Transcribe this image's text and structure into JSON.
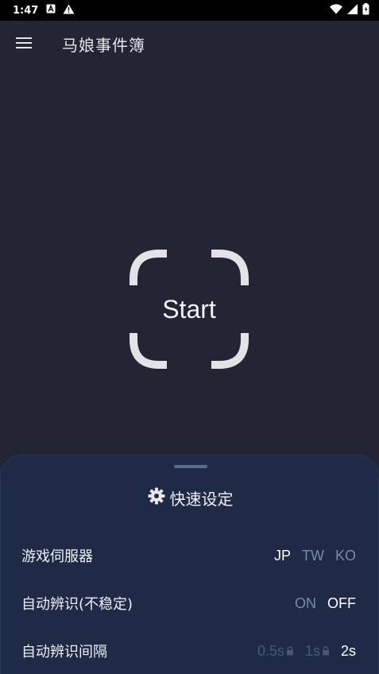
{
  "status_bar": {
    "time": "1:47",
    "left_icons": [
      "a-notification-icon",
      "warning-icon"
    ],
    "right_icons": [
      "wifi-icon",
      "cell-signal-icon",
      "battery-icon"
    ]
  },
  "app_bar": {
    "title": "马娘事件簿",
    "menu_icon": "hamburger-menu-icon"
  },
  "start": {
    "label": "Start"
  },
  "quick_settings": {
    "title": "快速设定",
    "icon": "gear-icon",
    "rows": [
      {
        "label": "游戏伺服器",
        "options": [
          {
            "label": "JP",
            "state": "active"
          },
          {
            "label": "TW",
            "state": "inactive"
          },
          {
            "label": "KO",
            "state": "inactive"
          }
        ]
      },
      {
        "label": "自动辨识(不稳定)",
        "options": [
          {
            "label": "ON",
            "state": "inactive"
          },
          {
            "label": "OFF",
            "state": "active"
          }
        ]
      },
      {
        "label": "自动辨识间隔",
        "options": [
          {
            "label": "0.5s",
            "state": "locked"
          },
          {
            "label": "1s",
            "state": "locked"
          },
          {
            "label": "2s",
            "state": "active"
          }
        ]
      }
    ]
  },
  "colors": {
    "background": "#222533",
    "sheet": "#1f2a47",
    "active_option": "#ffffff",
    "inactive_option": "#7d8aa6",
    "locked_option": "#4a5878"
  }
}
